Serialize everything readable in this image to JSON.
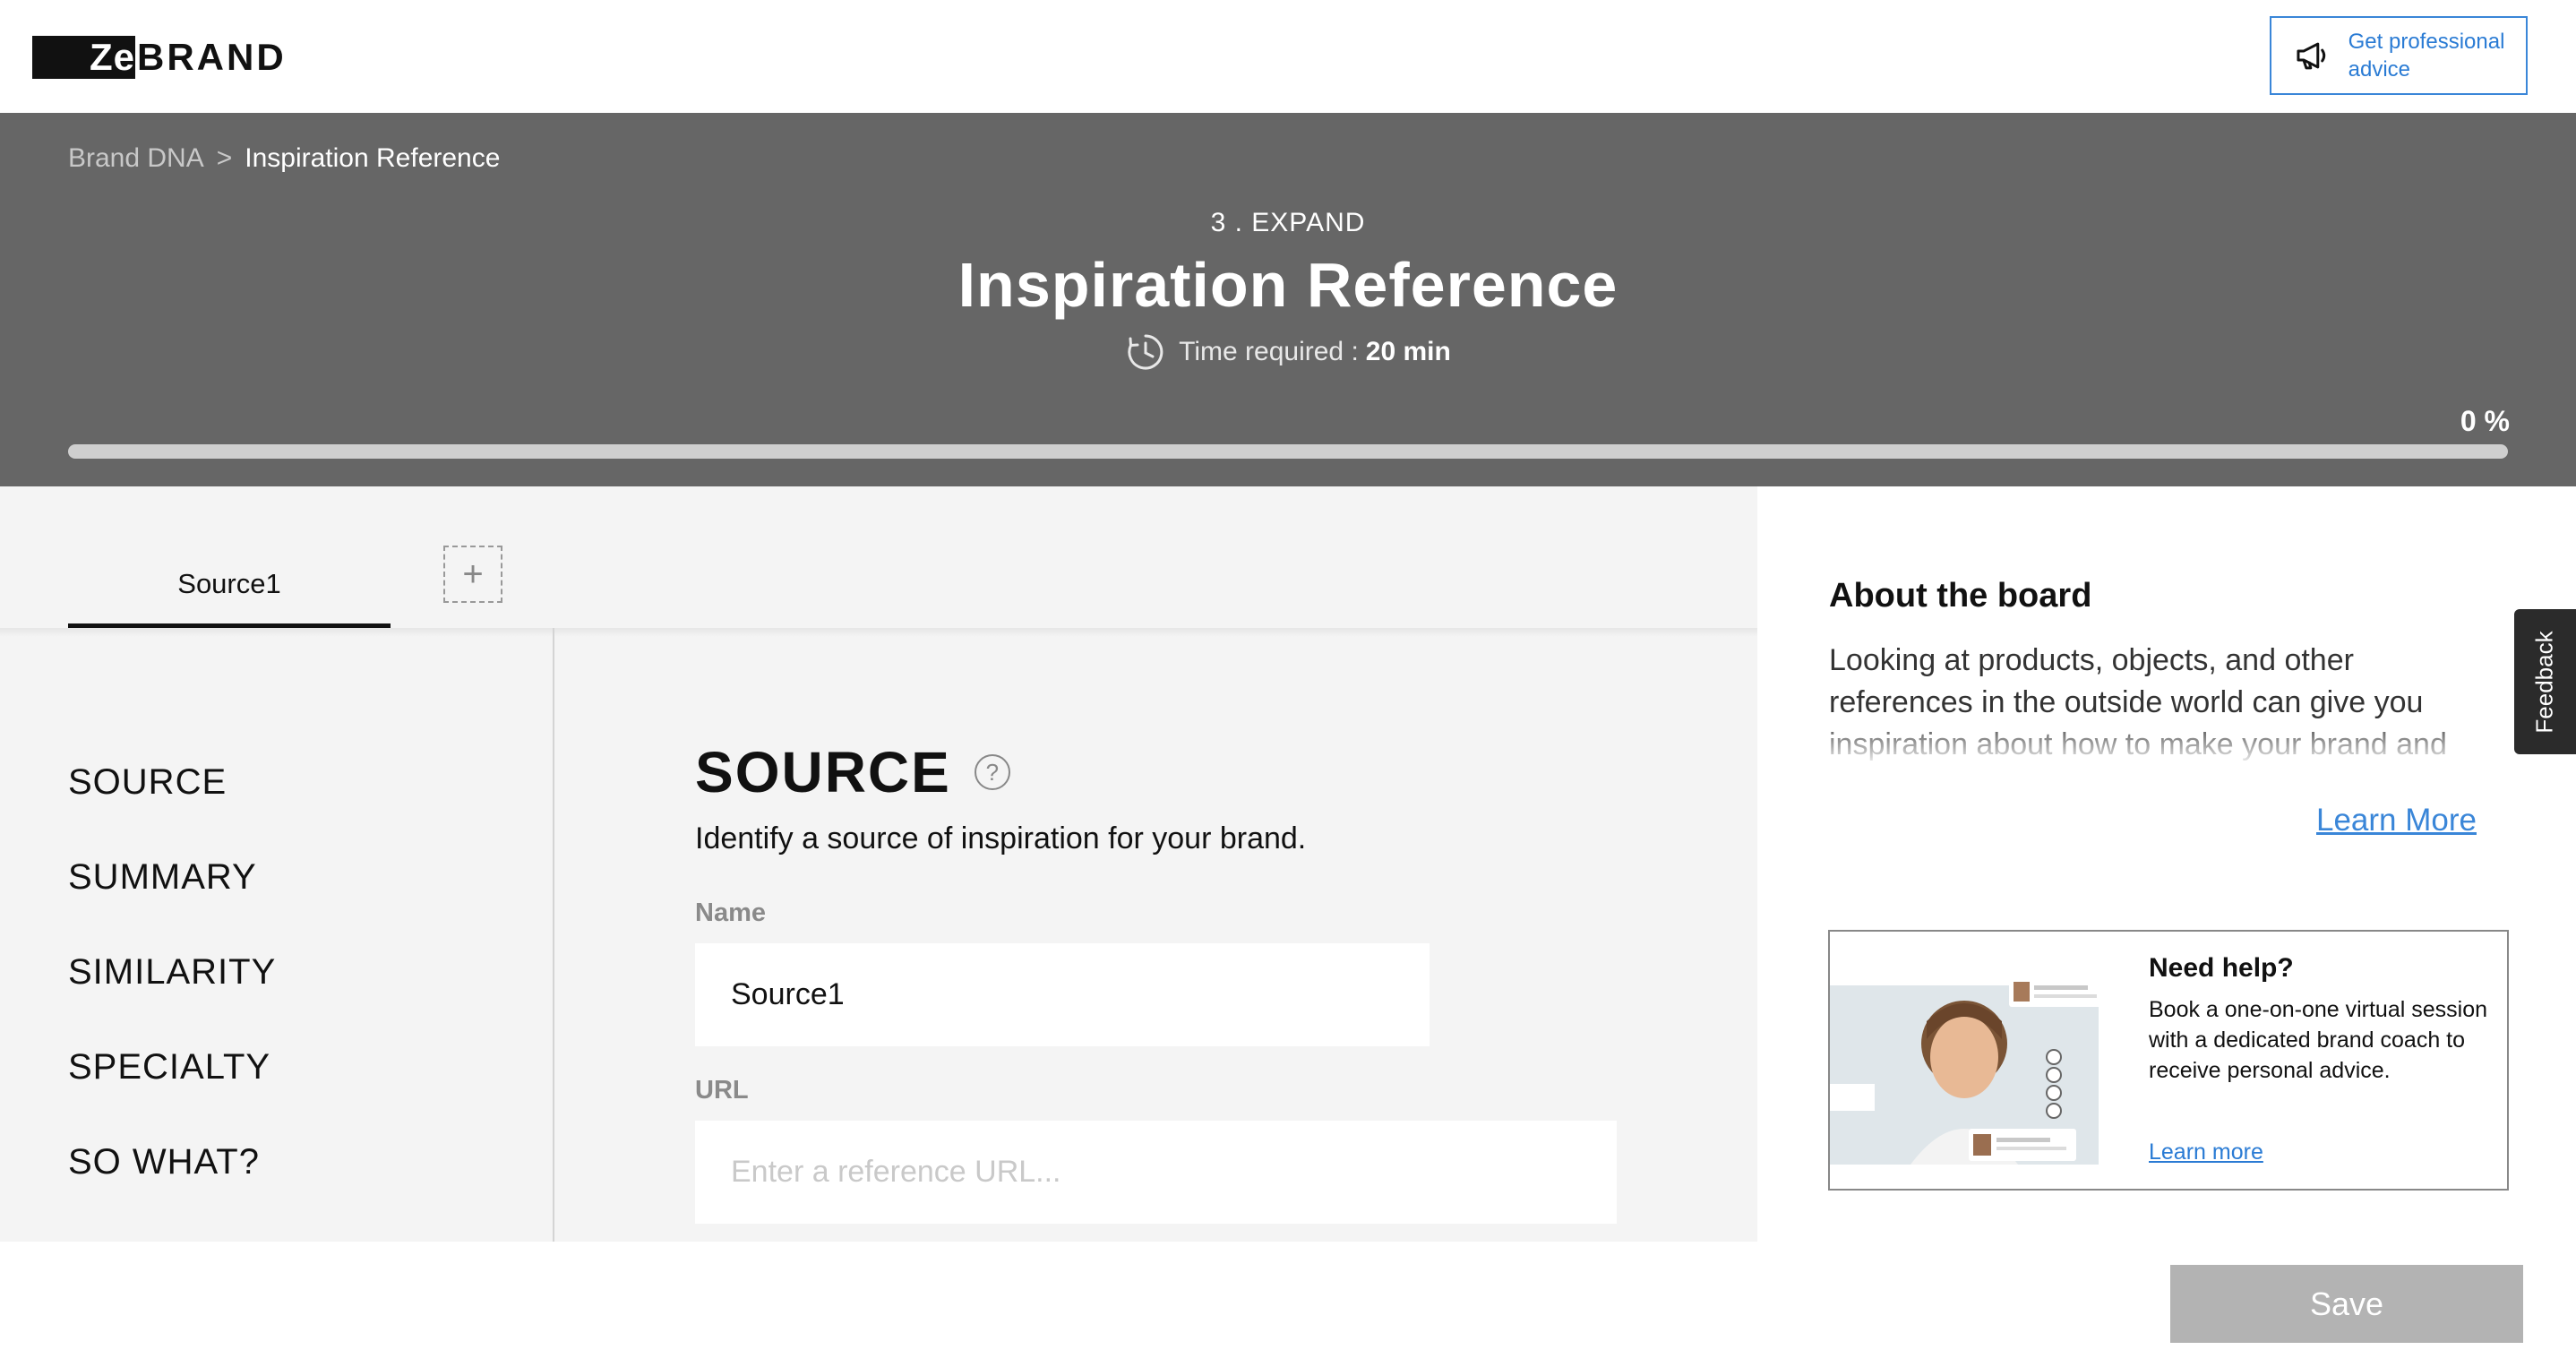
{
  "brand": {
    "logo_box": "Ze",
    "logo_rest": "BRAND"
  },
  "topbar": {
    "advice_label": "Get professional advice"
  },
  "breadcrumb": {
    "parent": "Brand DNA",
    "separator": ">",
    "current": "Inspiration Reference"
  },
  "header": {
    "step": "3 . EXPAND",
    "title": "Inspiration Reference",
    "time_label": "Time required :",
    "time_value": "20 min",
    "progress_label": "0 %",
    "progress_value": 0
  },
  "tabs": {
    "items": [
      {
        "label": "Source1"
      }
    ],
    "add_label": "+"
  },
  "nav": {
    "items": [
      {
        "label": "SOURCE"
      },
      {
        "label": "SUMMARY"
      },
      {
        "label": "SIMILARITY"
      },
      {
        "label": "SPECIALTY"
      },
      {
        "label": "SO WHAT?"
      }
    ]
  },
  "form": {
    "section_title": "SOURCE",
    "help_glyph": "?",
    "description": "Identify a source of inspiration for your brand.",
    "name_label": "Name",
    "name_value": "Source1",
    "url_label": "URL",
    "url_placeholder": "Enter a reference URL..."
  },
  "about": {
    "title": "About the board",
    "text": "Looking at products, objects, and other references in the outside world can give you inspiration about how to make your brand and",
    "learn_more": "Learn More"
  },
  "help_card": {
    "title": "Need help?",
    "text": "Book a one-on-one virtual session with a dedicated brand coach to receive personal advice.",
    "link": "Learn more"
  },
  "feedback": {
    "label": "Feedback"
  },
  "save": {
    "label": "Save"
  },
  "colors": {
    "accent": "#3a86d8",
    "header_bg": "#666666",
    "work_bg": "#f4f4f4",
    "save_bg": "#b3b3b3"
  },
  "icons": {
    "advice": "megaphone-icon",
    "time": "clock-icon",
    "help": "question-icon",
    "add": "plus-icon"
  }
}
